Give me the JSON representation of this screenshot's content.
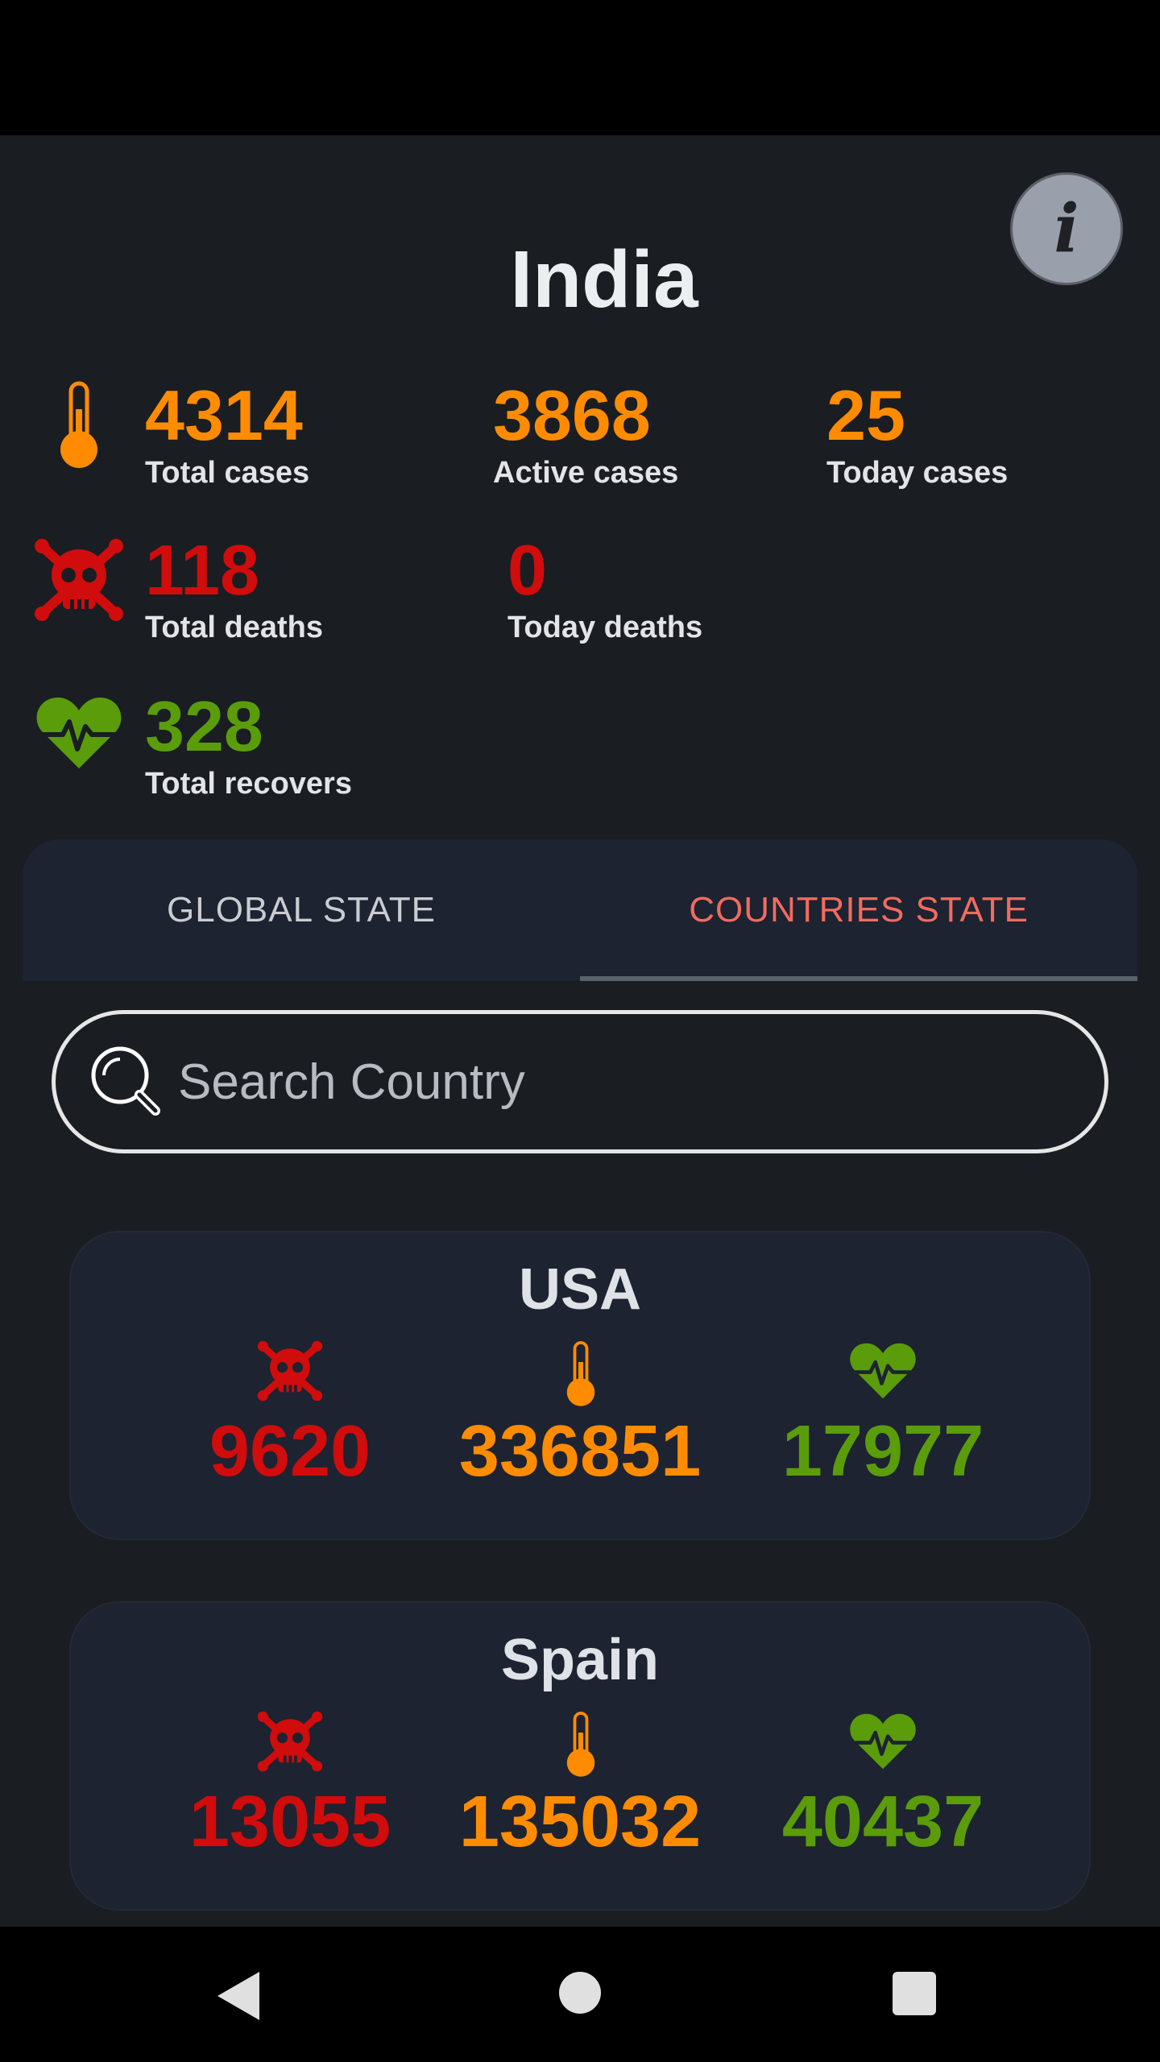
{
  "header": {
    "country": "India",
    "info_label": "i"
  },
  "stats": {
    "total_cases": {
      "value": "4314",
      "label": "Total cases"
    },
    "active_cases": {
      "value": "3868",
      "label": "Active cases"
    },
    "today_cases": {
      "value": "25",
      "label": "Today cases"
    },
    "total_deaths": {
      "value": "118",
      "label": "Total deaths"
    },
    "today_deaths": {
      "value": "0",
      "label": "Today deaths"
    },
    "total_recovers": {
      "value": "328",
      "label": "Total recovers"
    }
  },
  "tabs": [
    {
      "label": "GLOBAL STATE",
      "selected": false
    },
    {
      "label": "COUNTRIES STATE",
      "selected": true
    }
  ],
  "search": {
    "placeholder": "Search Country",
    "value": ""
  },
  "countries": [
    {
      "name": "USA",
      "deaths": "9620",
      "cases": "336851",
      "recovered": "17977"
    },
    {
      "name": "Spain",
      "deaths": "13055",
      "cases": "135032",
      "recovered": "40437"
    }
  ],
  "icons": {
    "cases": "thermometer-icon",
    "deaths": "skull-crossbones-icon",
    "recovers": "heartbeat-icon",
    "search": "search-icon",
    "info": "info-icon"
  },
  "colors": {
    "cases": "#ff8c00",
    "deaths": "#d00c0c",
    "recovers": "#5a9c0a",
    "selected_tab": "#f26b5f",
    "background": "#1a1d22",
    "card": "#1d2330"
  }
}
